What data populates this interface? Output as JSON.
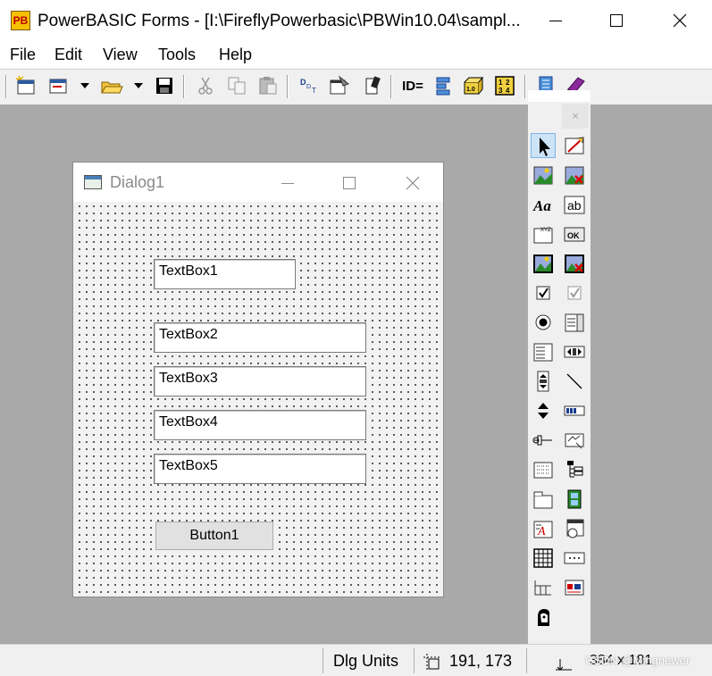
{
  "window": {
    "title": "PowerBASIC Forms - [I:\\FireflyPowerbasic\\PBWin10.04\\sampl...",
    "icon_text": "PB",
    "controls": [
      "minimize-icon",
      "maximize-icon",
      "close-icon"
    ]
  },
  "menu": {
    "items": [
      {
        "label": "File"
      },
      {
        "label": "Edit"
      },
      {
        "label": "View"
      },
      {
        "label": "Tools"
      },
      {
        "label": "Help"
      }
    ]
  },
  "toolbar": {
    "buttons": [
      "new-form-icon",
      "new-dropdown-icon",
      "open-folder-icon",
      "save-icon",
      "cut-icon",
      "copy-icon",
      "paste-icon",
      "tab-order-icon",
      "properties-icon",
      "code-icon",
      "control-id-icon",
      "align-icon",
      "size-icon",
      "grid-icon",
      "toolbox-icon",
      "menu-editor-icon"
    ],
    "id_label": "ID="
  },
  "dialog": {
    "title": "Dialog1",
    "textboxes": [
      {
        "text": "TextBox1"
      },
      {
        "text": "TextBox2"
      },
      {
        "text": "TextBox3"
      },
      {
        "text": "TextBox4"
      },
      {
        "text": "TextBox5"
      }
    ],
    "button": {
      "label": "Button1"
    }
  },
  "toolbox": {
    "close_label": "×",
    "tools": [
      "pointer-icon",
      "line-draw-icon",
      "image-icon",
      "image-x-icon",
      "label-icon",
      "textbox-icon",
      "frame-icon",
      "button-icon",
      "imagebutton-icon",
      "imagebutton-x-icon",
      "checkbox-icon",
      "checkbox3state-icon",
      "option-icon",
      "listbox-icon",
      "combobox-icon",
      "scrollbar-h-icon",
      "scrollbar-v-icon",
      "line-icon",
      "updown-icon",
      "progressbar-icon",
      "trackbar-icon",
      "statusbar-icon",
      "listview-icon",
      "treeview-icon",
      "tab-icon",
      "animate-icon",
      "richedit-icon",
      "custom-icon",
      "grid-icon",
      "ipaddress-icon",
      "header-icon",
      "datetime-icon",
      "user-icon"
    ]
  },
  "status": {
    "units": "Dlg Units",
    "position": "191, 173",
    "size": "384 x 181",
    "watermark": "CSDN @Mingnewer"
  }
}
